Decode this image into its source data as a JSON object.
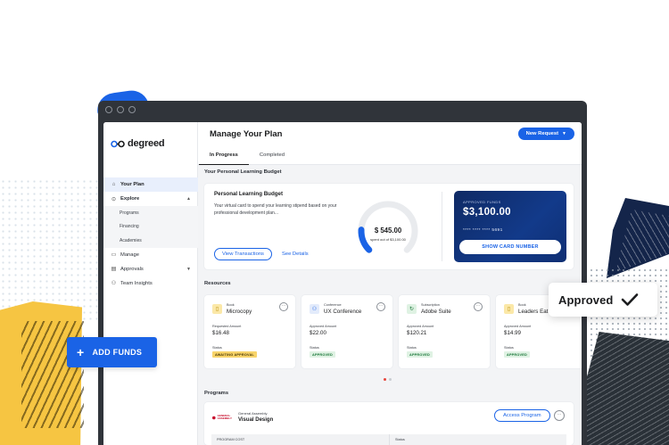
{
  "floating": {
    "add_funds_label": "ADD FUNDS",
    "approved_label": "Approved"
  },
  "sidebar": {
    "logo_text": "degreed",
    "items": [
      {
        "label": "Your Plan",
        "icon": "home-icon",
        "active": true
      },
      {
        "label": "Explore",
        "icon": "explore-icon",
        "expanded": true
      },
      {
        "label": "Programs",
        "sub": true
      },
      {
        "label": "Financing",
        "sub": true
      },
      {
        "label": "Academies",
        "sub": true
      },
      {
        "label": "Manage",
        "icon": "folder-icon"
      },
      {
        "label": "Approvals",
        "icon": "clipboard-icon",
        "collapsible": true
      },
      {
        "label": "Team Insights",
        "icon": "people-icon"
      }
    ]
  },
  "header": {
    "title": "Manage Your Plan",
    "new_request_label": "New Request",
    "tabs": [
      {
        "label": "In Progress",
        "active": true
      },
      {
        "label": "Completed",
        "active": false
      }
    ]
  },
  "budget": {
    "section_title": "Your Personal Learning Budget",
    "card_title": "Personal Learning Budget",
    "description": "Your virtual card to spend your learning stipend based on your professional development plan...",
    "view_transactions_label": "View Transactions",
    "see_details_label": "See Details",
    "spent_amount": "$ 545.00",
    "spent_caption": "spent out of $3,100.00",
    "spent_fraction": 0.176,
    "virtual_card": {
      "label": "APPROVED FUNDS",
      "amount": "$3,100.00",
      "card_number": "**** **** **** 5691",
      "show_button_label": "SHOW CARD NUMBER"
    }
  },
  "resources": {
    "section_title": "Resources",
    "items": [
      {
        "type": "Book",
        "name": "Microcopy",
        "amount_label": "Requested Amount",
        "amount": "$16.48",
        "status_label": "Status",
        "status": "AWAITING APPROVAL",
        "icon": "book-icon",
        "icon_bg": "#fbe8a8",
        "status_color": "yellow"
      },
      {
        "type": "Conference",
        "name": "UX Conference",
        "amount_label": "Approved Amount",
        "amount": "$22.00",
        "status_label": "Status",
        "status": "APPROVED",
        "icon": "conference-icon",
        "icon_bg": "#e3ebfb",
        "status_color": "green"
      },
      {
        "type": "Subscription",
        "name": "Adobe Suite",
        "amount_label": "Approved Amount",
        "amount": "$120.21",
        "status_label": "Status",
        "status": "APPROVED",
        "icon": "subscription-icon",
        "icon_bg": "#dff2e3",
        "status_color": "green"
      },
      {
        "type": "Book",
        "name": "Leaders Eat Last",
        "amount_label": "Approved Amount",
        "amount": "$14.99",
        "status_label": "Status",
        "status": "APPROVED",
        "icon": "book-icon",
        "icon_bg": "#fbe8a8",
        "status_color": "green"
      }
    ]
  },
  "programs": {
    "section_title": "Programs",
    "provider": "General Assembly",
    "provider_logo_text": "GENERAL ASSEMBLY",
    "name": "Visual Design",
    "access_label": "Access Program",
    "col_cost": "PROGRAM COST",
    "col_status": "Status"
  },
  "colors": {
    "accent": "#1a63e6",
    "card_navy": "#123a8a",
    "approved_green": "#137333",
    "awaiting_yellow": "#f8d46a"
  }
}
